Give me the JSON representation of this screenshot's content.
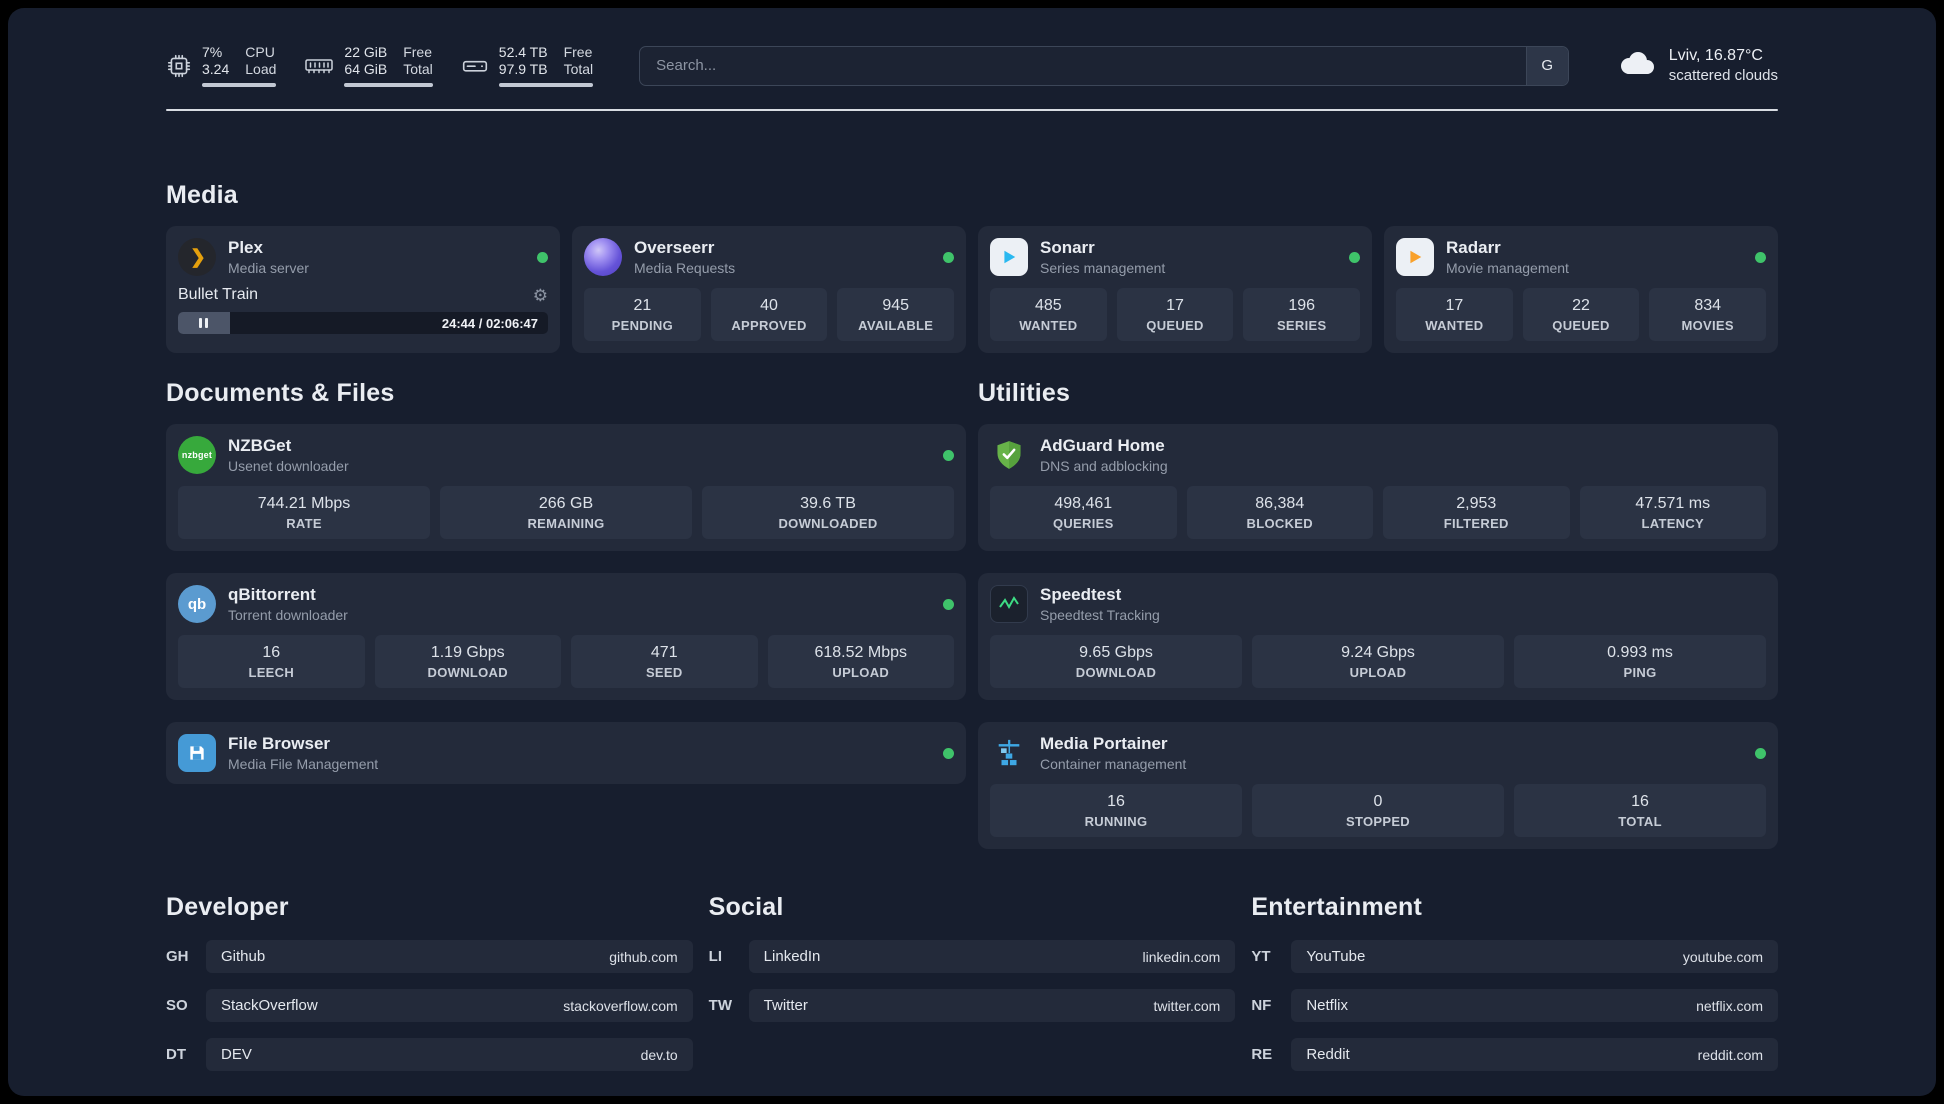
{
  "header": {
    "metrics": [
      {
        "icon": "cpu-icon",
        "values": [
          "7%",
          "3.24"
        ],
        "labels": [
          "CPU",
          "Load"
        ]
      },
      {
        "icon": "ram-icon",
        "values": [
          "22 GiB",
          "64 GiB"
        ],
        "labels": [
          "Free",
          "Total"
        ]
      },
      {
        "icon": "disk-icon",
        "values": [
          "52.4 TB",
          "97.9 TB"
        ],
        "labels": [
          "Free",
          "Total"
        ]
      }
    ],
    "search": {
      "placeholder": "Search...",
      "engine_button": "G"
    },
    "weather": {
      "icon": "cloud-icon",
      "location": "Lviv, 16.87°C",
      "condition": "scattered clouds"
    }
  },
  "media": {
    "title": "Media",
    "plex": {
      "icon": "plex-icon",
      "name": "Plex",
      "subtitle": "Media server",
      "now_playing": "Bullet Train",
      "time": "24:44 / 02:06:47"
    },
    "overseerr": {
      "icon": "overseerr-icon",
      "name": "Overseerr",
      "subtitle": "Media Requests",
      "stats": [
        {
          "value": "21",
          "label": "PENDING"
        },
        {
          "value": "40",
          "label": "APPROVED"
        },
        {
          "value": "945",
          "label": "AVAILABLE"
        }
      ]
    },
    "sonarr": {
      "icon": "sonarr-icon",
      "name": "Sonarr",
      "subtitle": "Series management",
      "stats": [
        {
          "value": "485",
          "label": "WANTED"
        },
        {
          "value": "17",
          "label": "QUEUED"
        },
        {
          "value": "196",
          "label": "SERIES"
        }
      ]
    },
    "radarr": {
      "icon": "radarr-icon",
      "name": "Radarr",
      "subtitle": "Movie management",
      "stats": [
        {
          "value": "17",
          "label": "WANTED"
        },
        {
          "value": "22",
          "label": "QUEUED"
        },
        {
          "value": "834",
          "label": "MOVIES"
        }
      ]
    }
  },
  "documents": {
    "title": "Documents & Files",
    "nzbget": {
      "icon": "nzbget-icon",
      "icon_text": "nzbget",
      "name": "NZBGet",
      "subtitle": "Usenet downloader",
      "stats": [
        {
          "value": "744.21 Mbps",
          "label": "RATE"
        },
        {
          "value": "266 GB",
          "label": "REMAINING"
        },
        {
          "value": "39.6 TB",
          "label": "DOWNLOADED"
        }
      ]
    },
    "qbittorrent": {
      "icon": "qbittorrent-icon",
      "icon_text": "qb",
      "name": "qBittorrent",
      "subtitle": "Torrent downloader",
      "stats": [
        {
          "value": "16",
          "label": "LEECH"
        },
        {
          "value": "1.19 Gbps",
          "label": "DOWNLOAD"
        },
        {
          "value": "471",
          "label": "SEED"
        },
        {
          "value": "618.52 Mbps",
          "label": "UPLOAD"
        }
      ]
    },
    "filebrowser": {
      "icon": "filebrowser-icon",
      "name": "File Browser",
      "subtitle": "Media File Management"
    }
  },
  "utilities": {
    "title": "Utilities",
    "adguard": {
      "icon": "adguard-icon",
      "name": "AdGuard Home",
      "subtitle": "DNS and adblocking",
      "stats": [
        {
          "value": "498,461",
          "label": "QUERIES"
        },
        {
          "value": "86,384",
          "label": "BLOCKED"
        },
        {
          "value": "2,953",
          "label": "FILTERED"
        },
        {
          "value": "47.571 ms",
          "label": "LATENCY"
        }
      ]
    },
    "speedtest": {
      "icon": "speedtest-icon",
      "name": "Speedtest",
      "subtitle": "Speedtest Tracking",
      "stats": [
        {
          "value": "9.65 Gbps",
          "label": "DOWNLOAD"
        },
        {
          "value": "9.24 Gbps",
          "label": "UPLOAD"
        },
        {
          "value": "0.993 ms",
          "label": "PING"
        }
      ]
    },
    "portainer": {
      "icon": "portainer-icon",
      "name": "Media Portainer",
      "subtitle": "Container management",
      "stats": [
        {
          "value": "16",
          "label": "RUNNING"
        },
        {
          "value": "0",
          "label": "STOPPED"
        },
        {
          "value": "16",
          "label": "TOTAL"
        }
      ]
    }
  },
  "links": {
    "developer": {
      "title": "Developer",
      "items": [
        {
          "tag": "GH",
          "name": "Github",
          "url": "github.com"
        },
        {
          "tag": "SO",
          "name": "StackOverflow",
          "url": "stackoverflow.com"
        },
        {
          "tag": "DT",
          "name": "DEV",
          "url": "dev.to"
        }
      ]
    },
    "social": {
      "title": "Social",
      "items": [
        {
          "tag": "LI",
          "name": "LinkedIn",
          "url": "linkedin.com"
        },
        {
          "tag": "TW",
          "name": "Twitter",
          "url": "twitter.com"
        }
      ]
    },
    "entertainment": {
      "title": "Entertainment",
      "items": [
        {
          "tag": "YT",
          "name": "YouTube",
          "url": "youtube.com"
        },
        {
          "tag": "NF",
          "name": "Netflix",
          "url": "netflix.com"
        },
        {
          "tag": "RE",
          "name": "Reddit",
          "url": "reddit.com"
        }
      ]
    }
  },
  "colors": {
    "background": "#171e2e",
    "card": "#232a3a",
    "stat_box": "#2b3344",
    "status_online": "#3fc36a",
    "plex_gold": "#e5a00d",
    "sonarr_blue": "#29b8f0",
    "radarr_orange": "#f9a12b",
    "nzbget_green": "#37a93c",
    "qbittorrent_blue": "#5b9bd0",
    "adguard_green": "#67b349",
    "portainer_blue": "#3ea8e5"
  }
}
